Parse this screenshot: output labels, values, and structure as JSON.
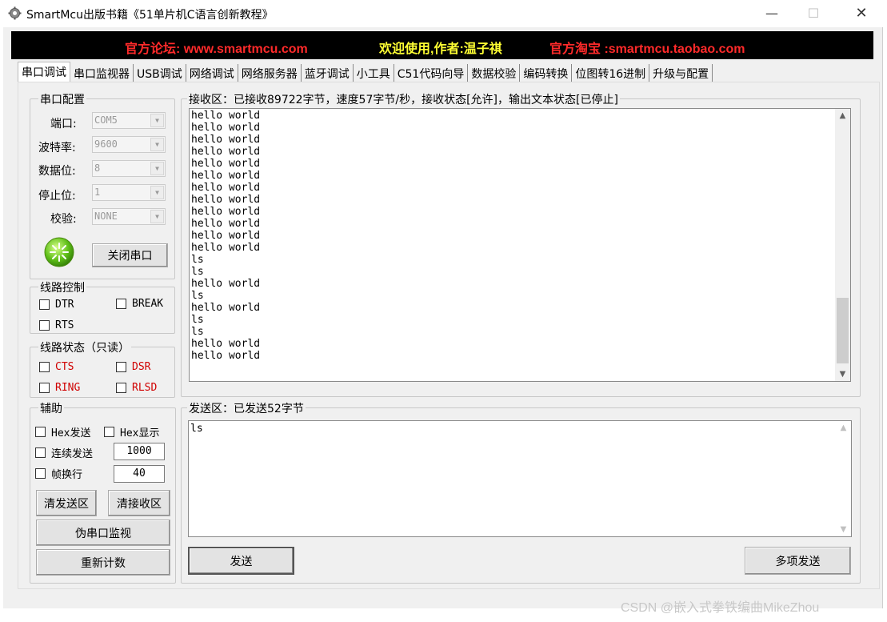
{
  "window": {
    "title": "SmartMcu出版书籍《51单片机C语言创新教程》",
    "minimize_glyph": "—",
    "maximize_glyph": "☐",
    "close_glyph": "✕"
  },
  "banner": {
    "forum": "官方论坛: www.smartmcu.com",
    "welcome": "欢迎使用,作者:温子祺",
    "taobao": "官方淘宝 :smartmcu.taobao.com",
    "colors": {
      "forum": "#ff2a2a",
      "welcome": "#ffff33",
      "taobao": "#ff2a2a"
    }
  },
  "tabs": [
    "串口调试",
    "串口监视器",
    "USB调试",
    "网络调试",
    "网络服务器",
    "蓝牙调试",
    "小工具",
    "C51代码向导",
    "数据校验",
    "编码转换",
    "位图转16进制",
    "升级与配置"
  ],
  "serial_config": {
    "legend": "串口配置",
    "port_label": "端口:",
    "port_value": "COM5",
    "baud_label": "波特率:",
    "baud_value": "9600",
    "databits_label": "数据位:",
    "databits_value": "8",
    "stopbits_label": "停止位:",
    "stopbits_value": "1",
    "parity_label": "校验:",
    "parity_value": "NONE",
    "close_button": "关闭串口"
  },
  "line_control": {
    "legend": "线路控制",
    "dtr": "DTR",
    "break": "BREAK",
    "rts": "RTS"
  },
  "line_status": {
    "legend": "线路状态（只读）",
    "cts": "CTS",
    "dsr": "DSR",
    "ring": "RING",
    "rlsd": "RLSD"
  },
  "assist": {
    "legend": "辅助",
    "hex_send": "Hex发送",
    "hex_show": "Hex显示",
    "continuous_send": "连续发送",
    "continuous_value": "1000",
    "frame_newline": "帧换行",
    "frame_value": "40",
    "clear_send": "清发送区",
    "clear_recv": "清接收区",
    "pseudo_monitor": "伪串口监视",
    "recount": "重新计数"
  },
  "receive": {
    "legend": "接收区：已接收89722字节，速度57字节/秒，接收状态[允许]，输出文本状态[已停止]",
    "lines": [
      "hello world",
      "hello world",
      "hello world",
      "hello world",
      "hello world",
      "hello world",
      "hello world",
      "hello world",
      "hello world",
      "hello world",
      "hello world",
      "hello world",
      "ls",
      "ls",
      "hello world",
      "ls",
      "hello world",
      "ls",
      "ls",
      "hello world",
      "hello world"
    ]
  },
  "send": {
    "legend": "发送区：已发送52字节",
    "text": "ls",
    "send_button": "发送",
    "multi_send_button": "多项发送"
  },
  "watermark": "CSDN @嵌入式拳铁编曲MikeZhou"
}
